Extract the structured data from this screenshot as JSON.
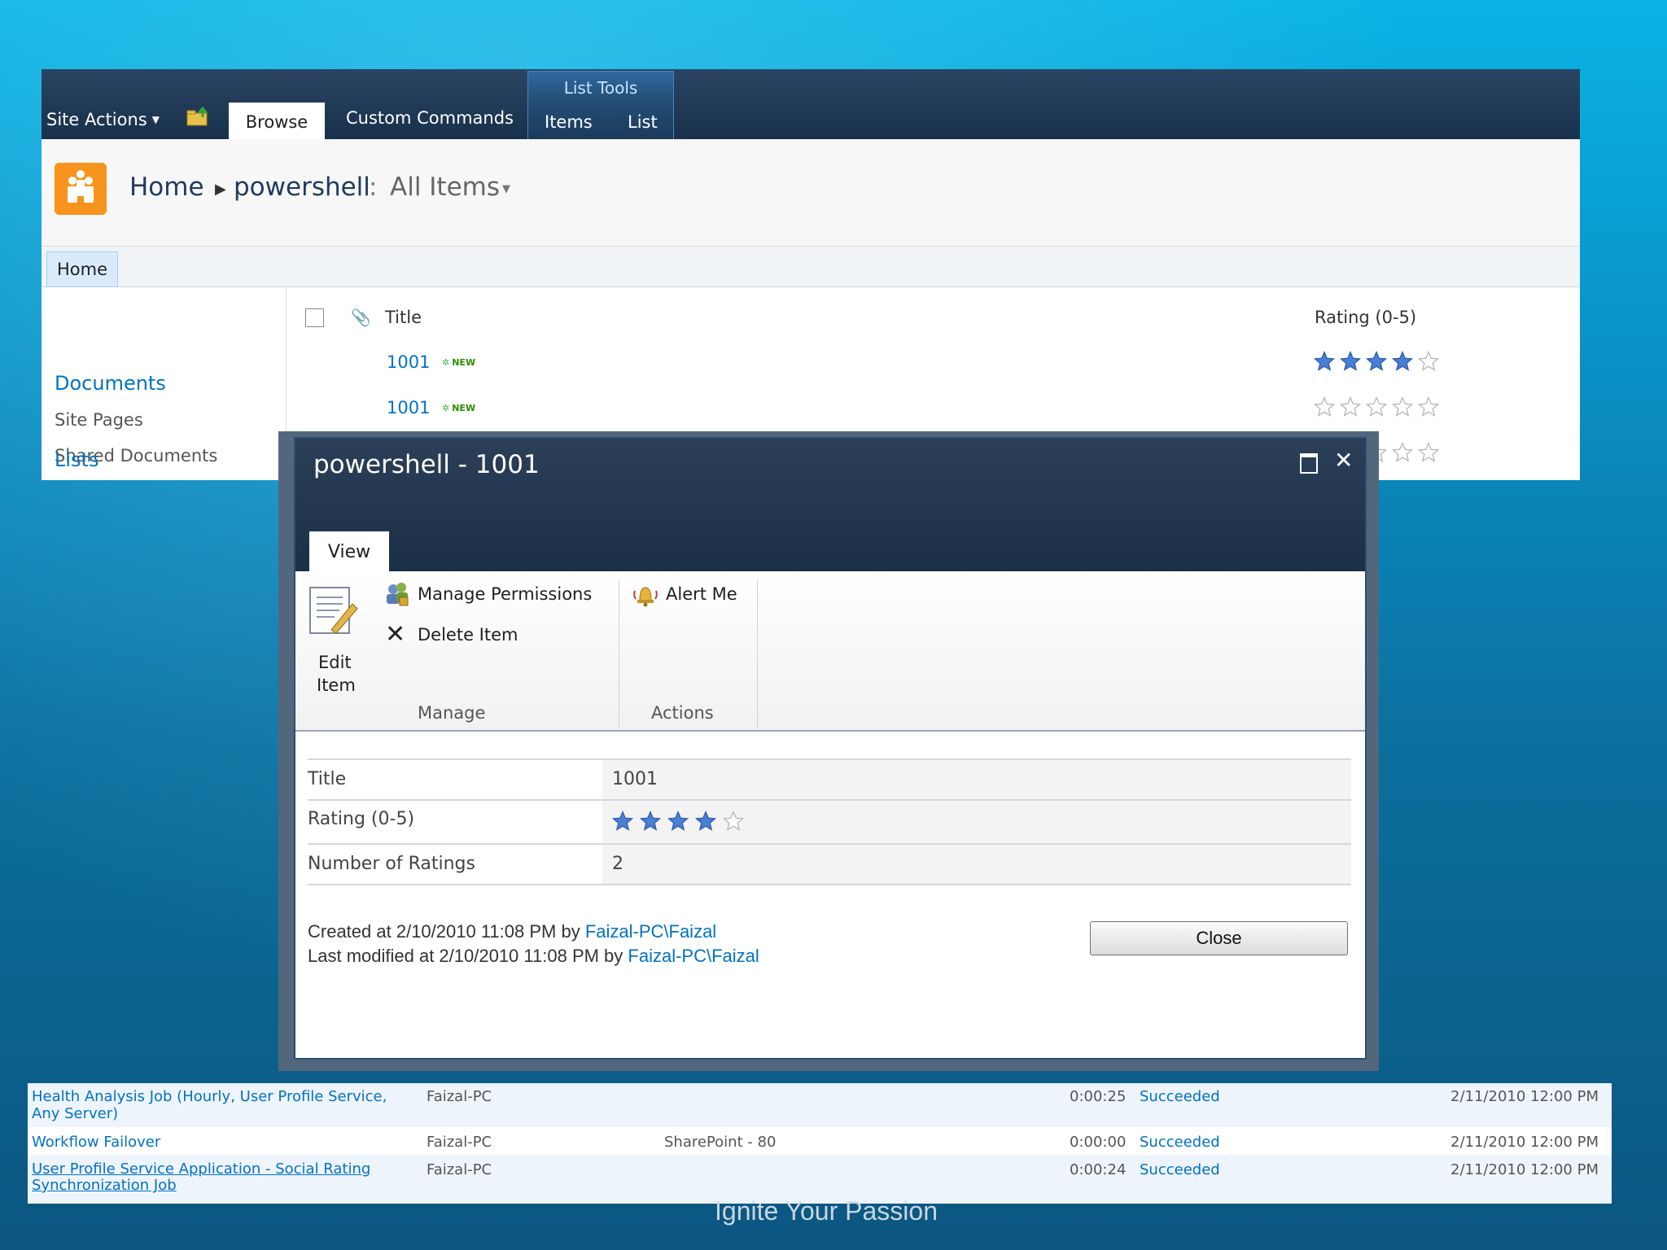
{
  "ribbon": {
    "site_actions": "Site Actions",
    "tabs": [
      "Browse",
      "Custom Commands"
    ],
    "contextual_group": "List Tools",
    "contextual_tabs": [
      "Items",
      "List"
    ]
  },
  "breadcrumb": {
    "home": "Home",
    "list": "powershell",
    "separator": ":",
    "view": "All Items"
  },
  "topnav": {
    "home": "Home"
  },
  "quicklaunch": {
    "documents_heading": "Documents",
    "items": [
      "Site Pages",
      "Shared Documents"
    ],
    "lists_heading": "Lists"
  },
  "list": {
    "columns": {
      "title": "Title",
      "rating": "Rating (0-5)"
    },
    "new_badge": "NEW",
    "rows": [
      {
        "title": "1001",
        "rating": 4
      },
      {
        "title": "1001",
        "rating": 0
      },
      {
        "title": "",
        "rating": 0
      }
    ]
  },
  "dialog": {
    "title": "powershell - 1001",
    "tab": "View",
    "edit_item": [
      "Edit",
      "Item"
    ],
    "manage_permissions": "Manage Permissions",
    "delete_item": "Delete Item",
    "alert_me": "Alert Me",
    "group_manage": "Manage",
    "group_actions": "Actions",
    "fields": [
      {
        "label": "Title",
        "value": "1001"
      },
      {
        "label": "Rating (0-5)",
        "rating": 4
      },
      {
        "label": "Number of Ratings",
        "value": "2"
      }
    ],
    "created_prefix": "Created at 2/10/2010 11:08 PM by ",
    "modified_prefix": "Last modified at 2/10/2010 11:08 PM by ",
    "author": "Faizal-PC\\Faizal",
    "close_label": "Close"
  },
  "jobs": [
    {
      "name1": "Health Analysis Job (Hourly, User Profile Service,",
      "name2": "Any Server)",
      "server": "Faizal-PC",
      "web_app": "",
      "duration": "0:00:25",
      "status": "Succeeded",
      "completed": "2/11/2010 12:00 PM"
    },
    {
      "name1": "Workflow Failover",
      "name2": "",
      "server": "Faizal-PC",
      "web_app": "SharePoint - 80",
      "duration": "0:00:00",
      "status": "Succeeded",
      "completed": "2/11/2010 12:00 PM"
    },
    {
      "name1": "User Profile Service Application - Social Rating",
      "name2": "Synchronization Job",
      "server": "Faizal-PC",
      "web_app": "",
      "duration": "0:00:24",
      "status": "Succeeded",
      "completed": "2/11/2010 12:00 PM"
    }
  ],
  "caption": "Ignite Your Passion",
  "colors": {
    "ribbon": "#1e3752",
    "link": "#0072c6",
    "star": "#4a7fd6"
  },
  "icons": [
    "chevron-down-icon",
    "navigate-up-icon",
    "site-logo-icon",
    "breadcrumb-arrow-icon",
    "paperclip-icon",
    "new-badge-icon",
    "star-icon",
    "maximize-icon",
    "close-icon",
    "edit-item-icon",
    "manage-permissions-icon",
    "delete-icon",
    "alert-bell-icon"
  ]
}
